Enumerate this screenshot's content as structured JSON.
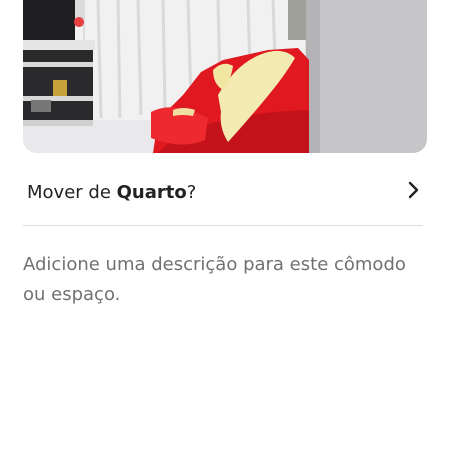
{
  "photo": {
    "description_icon": "room-photo"
  },
  "move_row": {
    "prefix": "Mover de ",
    "room": "Quarto",
    "suffix": "?",
    "icon": "chevron-right-icon"
  },
  "description": {
    "placeholder": "Adicione uma descrição para este cômodo ou espaço."
  },
  "colors": {
    "text_primary": "#222222",
    "text_secondary": "#717171",
    "divider": "#dddddd",
    "sofa": "#e0181f"
  }
}
